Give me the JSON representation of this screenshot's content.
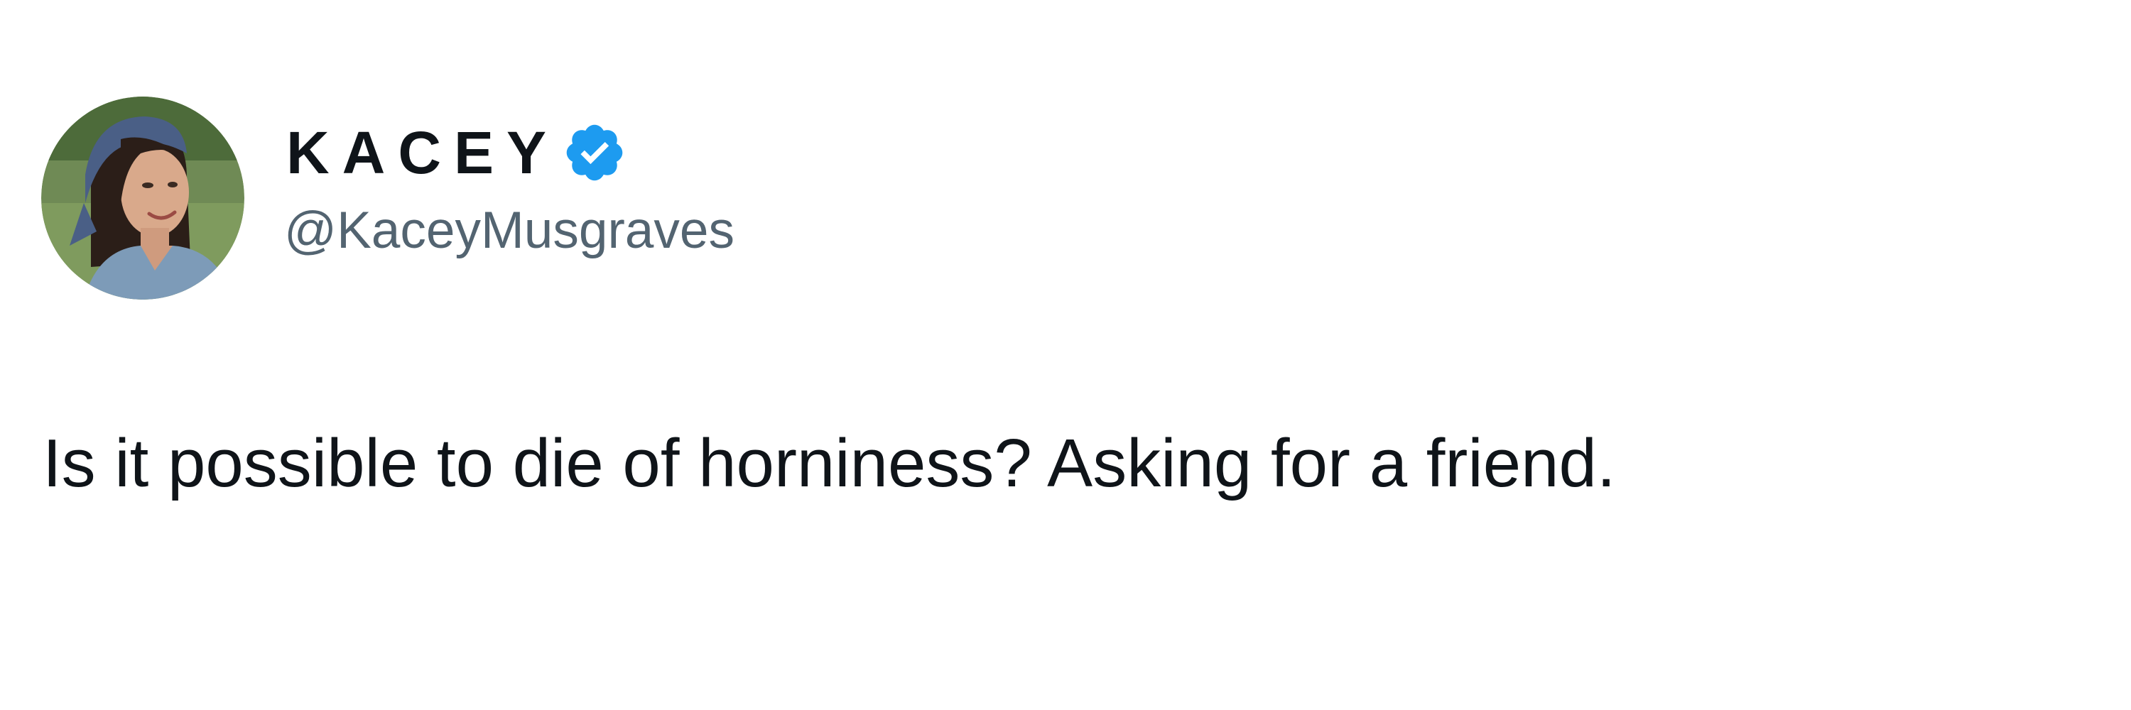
{
  "author": {
    "display_name": "KACEY",
    "handle": "@KaceyMusgraves",
    "verified_icon": "verified-badge-icon",
    "avatar_icon": "profile-photo"
  },
  "tweet": {
    "text": "Is it possible to die of horniness? Asking for a friend."
  },
  "colors": {
    "verified": "#1d9bf0",
    "primary_text": "#0f1419",
    "secondary_text": "#536471",
    "background": "#ffffff"
  }
}
